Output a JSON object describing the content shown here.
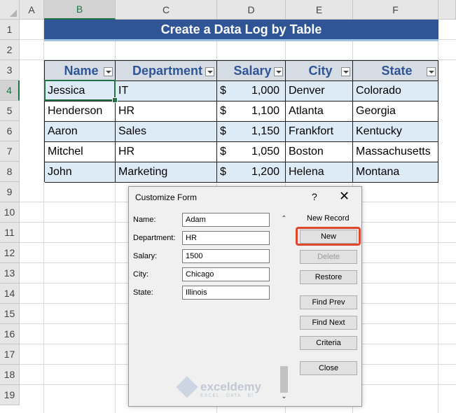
{
  "columns": [
    "A",
    "B",
    "C",
    "D",
    "E",
    "F"
  ],
  "rows": [
    "1",
    "2",
    "3",
    "4",
    "5",
    "6",
    "7",
    "8",
    "9",
    "10",
    "11",
    "12",
    "13",
    "14",
    "15",
    "16",
    "17",
    "18",
    "19"
  ],
  "banner": "Create a Data Log by Table",
  "table": {
    "headers": [
      "Name",
      "Department",
      "Salary",
      "City",
      "State"
    ],
    "rows": [
      {
        "name": "Jessica",
        "dept": "IT",
        "cur": "$",
        "salary": "1,000",
        "city": "Denver",
        "state": "Colorado"
      },
      {
        "name": "Henderson",
        "dept": "HR",
        "cur": "$",
        "salary": "1,100",
        "city": "Atlanta",
        "state": "Georgia"
      },
      {
        "name": "Aaron",
        "dept": "Sales",
        "cur": "$",
        "salary": "1,150",
        "city": "Frankfort",
        "state": "Kentucky"
      },
      {
        "name": "Mitchel",
        "dept": "HR",
        "cur": "$",
        "salary": "1,050",
        "city": "Boston",
        "state": "Massachusetts"
      },
      {
        "name": "John",
        "dept": "Marketing",
        "cur": "$",
        "salary": "1,200",
        "city": "Helena",
        "state": "Montana"
      }
    ]
  },
  "dialog": {
    "title": "Customize Form",
    "help": "?",
    "close": "✕",
    "record_label": "New Record",
    "fields": [
      {
        "label": "Name:",
        "value": "Adam"
      },
      {
        "label": "Department:",
        "value": "HR"
      },
      {
        "label": "Salary:",
        "value": "1500"
      },
      {
        "label": "City:",
        "value": "Chicago"
      },
      {
        "label": "State:",
        "value": "Illinois"
      }
    ],
    "buttons": {
      "new": "New",
      "delete": "Delete",
      "restore": "Restore",
      "find_prev": "Find Prev",
      "find_next": "Find Next",
      "criteria": "Criteria",
      "close": "Close"
    },
    "scroll_up": "⌃",
    "scroll_down": "⌄"
  },
  "watermark": {
    "text": "exceldemy",
    "sub": "EXCEL · DATA · BI"
  }
}
